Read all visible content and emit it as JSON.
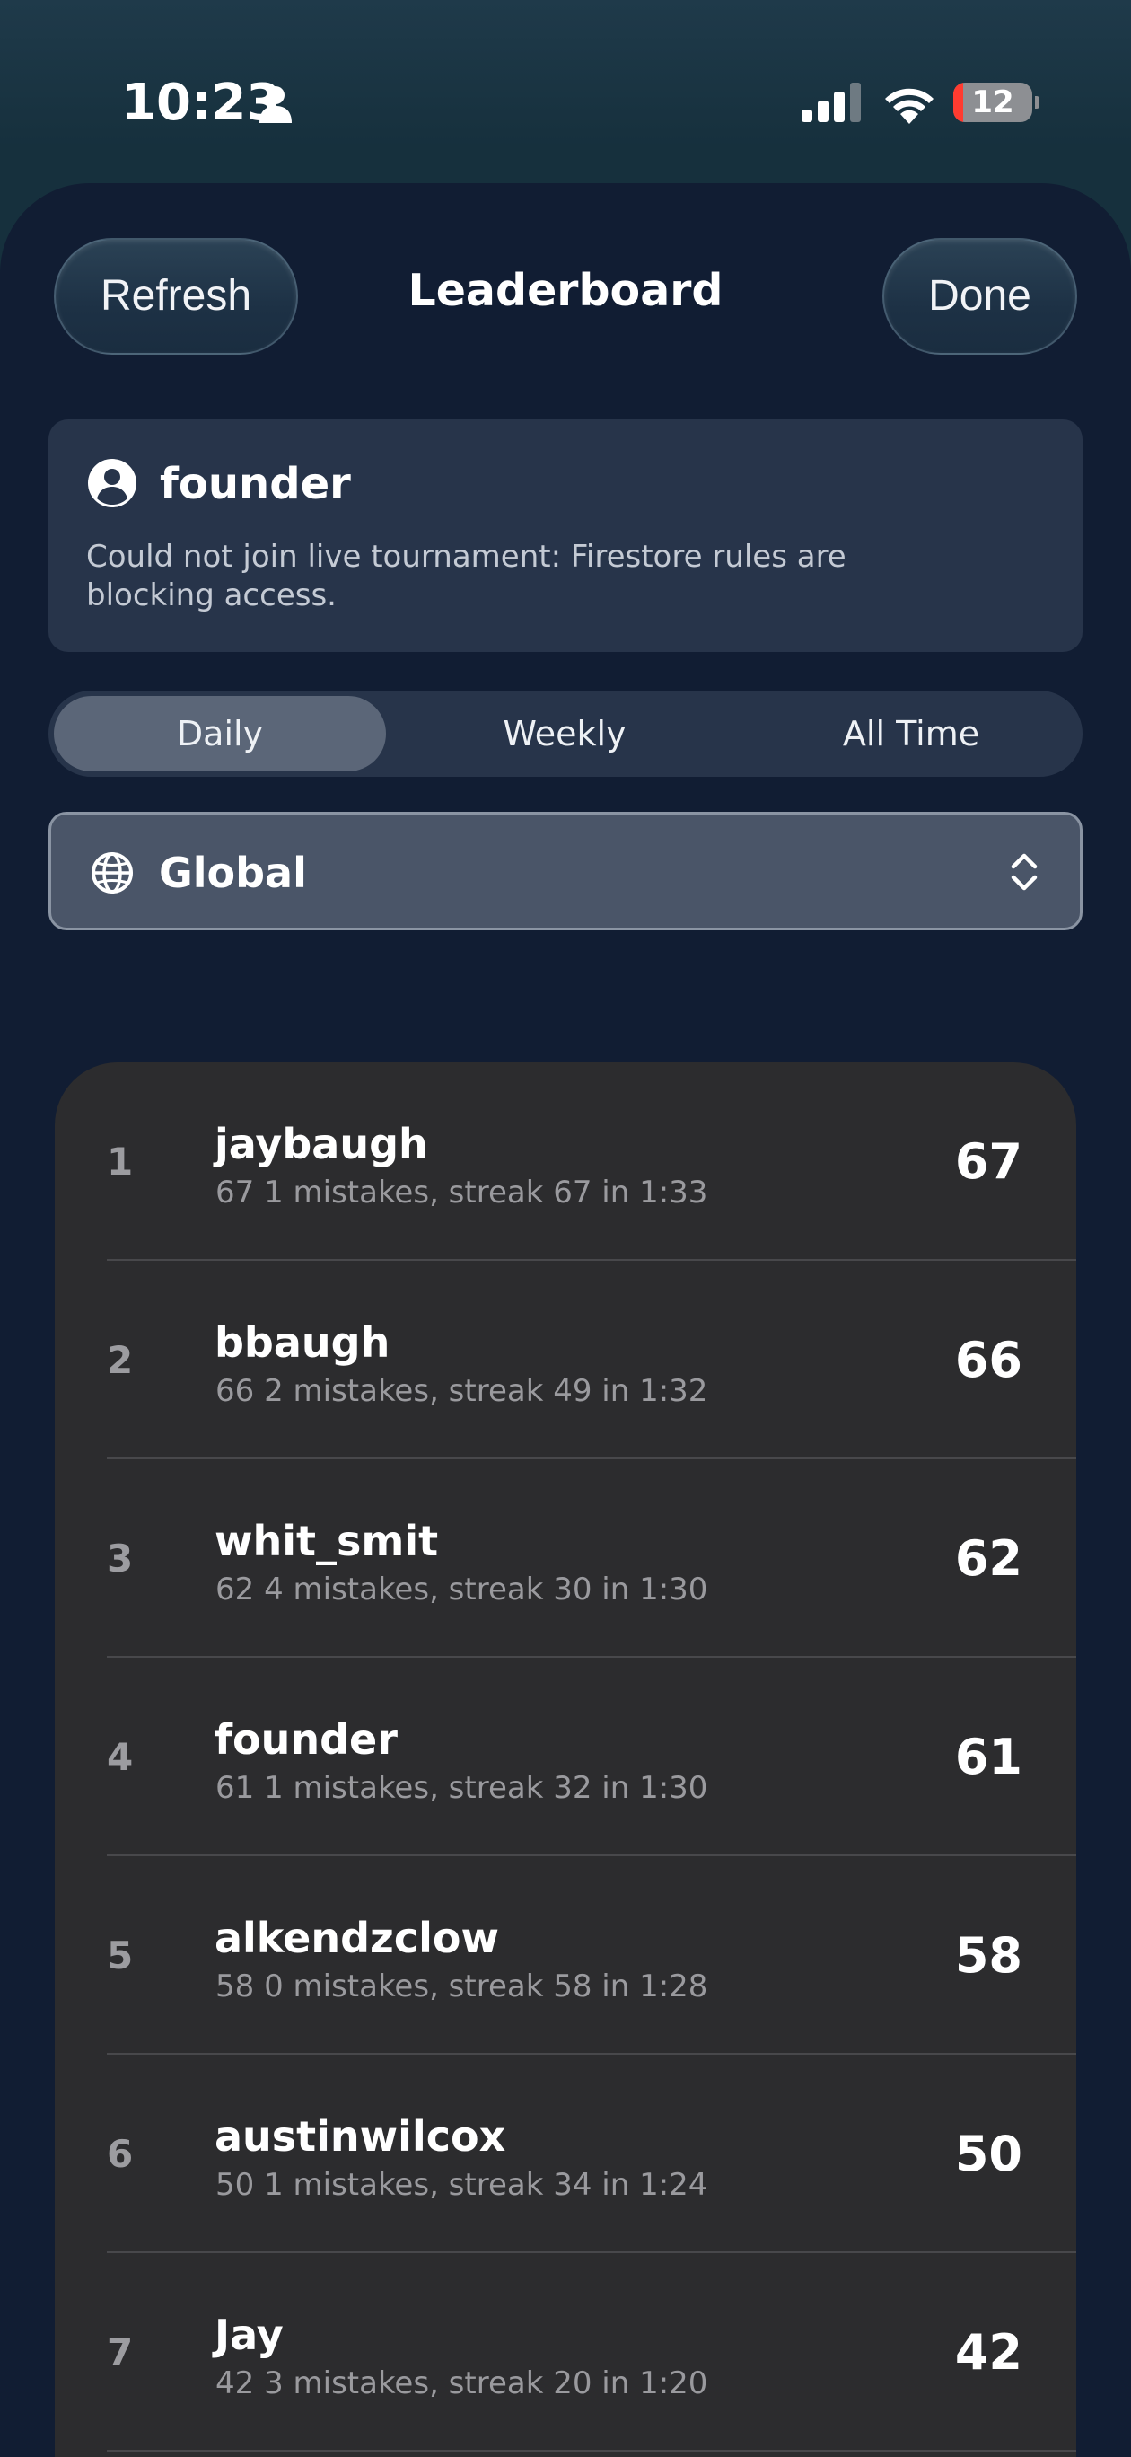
{
  "status_bar": {
    "time": "10:23",
    "battery_level": "12",
    "battery_fraction": 0.12,
    "icons": [
      "person-icon",
      "signal-icon",
      "wifi-icon",
      "battery-icon"
    ]
  },
  "header": {
    "refresh_label": "Refresh",
    "title": "Leaderboard",
    "done_label": "Done"
  },
  "info_card": {
    "icon": "user-circle-icon",
    "username": "founder",
    "message": "Could not join live tournament: Firestore rules are blocking access."
  },
  "tabs": {
    "selected": "Daily",
    "items": [
      {
        "label": "Daily"
      },
      {
        "label": "Weekly"
      },
      {
        "label": "All Time"
      }
    ]
  },
  "scope": {
    "icon": "globe-icon",
    "selected": "Global",
    "chevron": "chevron-updown-icon"
  },
  "leaderboard": {
    "rows": [
      {
        "rank": "1",
        "name": "jaybaugh",
        "detail": "67 1 mistakes, streak 67 in 1:33",
        "score": "67"
      },
      {
        "rank": "2",
        "name": "bbaugh",
        "detail": "66 2 mistakes, streak 49 in 1:32",
        "score": "66"
      },
      {
        "rank": "3",
        "name": "whit_smit",
        "detail": "62 4 mistakes, streak 30 in 1:30",
        "score": "62"
      },
      {
        "rank": "4",
        "name": "founder",
        "detail": "61 1 mistakes, streak 32 in 1:30",
        "score": "61"
      },
      {
        "rank": "5",
        "name": "alkendzclow",
        "detail": "58 0 mistakes, streak 58 in 1:28",
        "score": "58"
      },
      {
        "rank": "6",
        "name": "austinwilcox",
        "detail": "50 1 mistakes, streak 34 in 1:24",
        "score": "50"
      },
      {
        "rank": "7",
        "name": "Jay",
        "detail": "42 3 mistakes, streak 20 in 1:20",
        "score": "42"
      }
    ]
  },
  "colors": {
    "sheet_background": "#111d33",
    "card_background": "#27344a",
    "list_background": "#2c2c2e",
    "battery_low": "#ff3b30"
  }
}
